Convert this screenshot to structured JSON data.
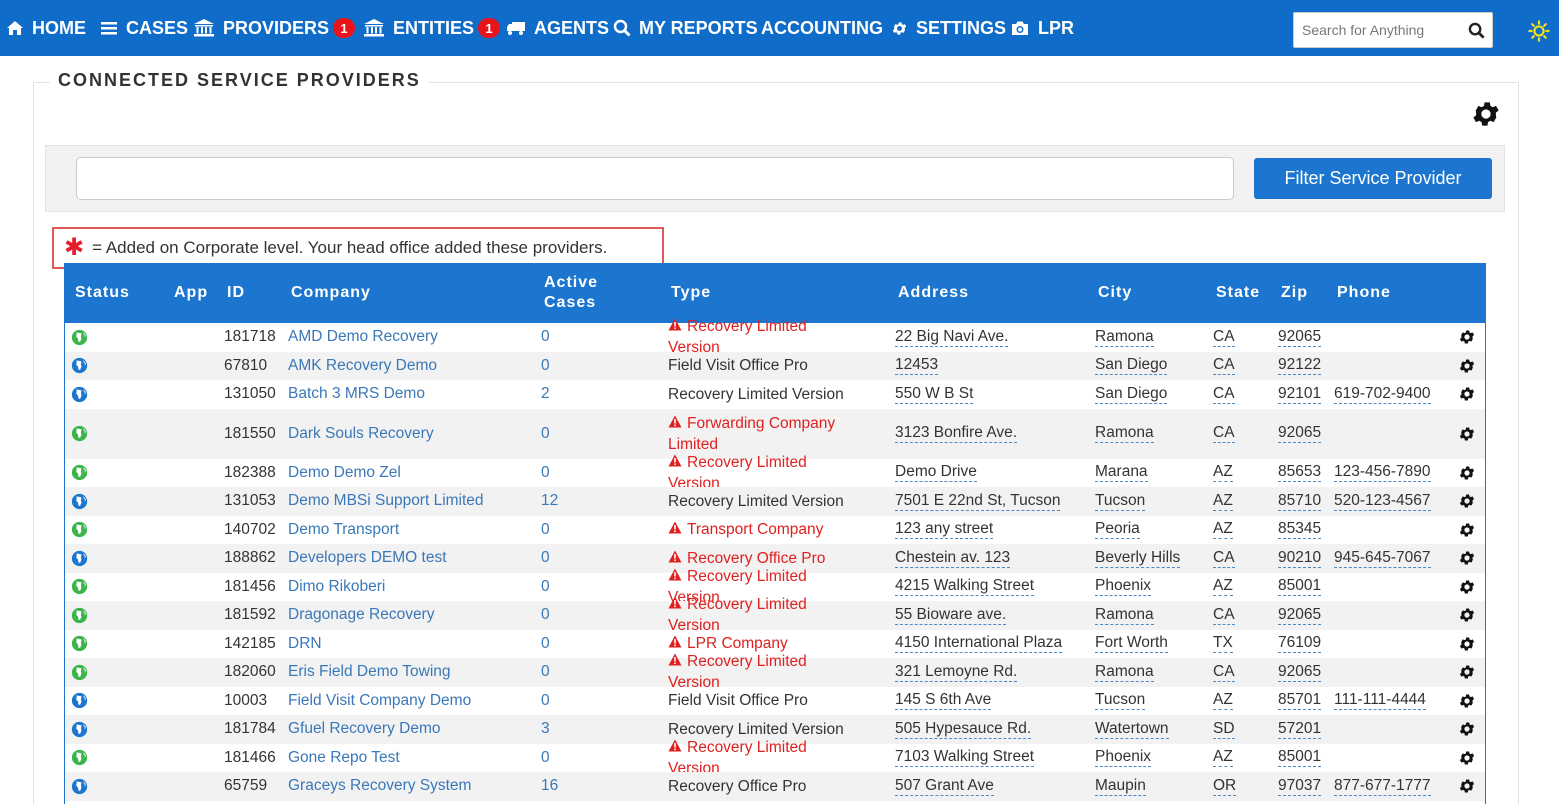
{
  "nav": {
    "items": [
      {
        "label": "HOME",
        "icon": "home-icon"
      },
      {
        "label": "CASES",
        "icon": "bars-icon"
      },
      {
        "label": "PROVIDERS",
        "icon": "bank-icon",
        "badge": "1"
      },
      {
        "label": "ENTITIES",
        "icon": "bank-icon",
        "badge": "1"
      },
      {
        "label": "AGENTS",
        "icon": "truck-icon"
      },
      {
        "label": "MY REPORTS",
        "icon": "search-icon"
      },
      {
        "label": "ACCOUNTING",
        "icon": ""
      },
      {
        "label": "SETTINGS",
        "icon": "gear-icon"
      },
      {
        "label": "LPR",
        "icon": "camera-icon"
      }
    ],
    "search_placeholder": "Search for Anything"
  },
  "page": {
    "title": "CONNECTED SERVICE PROVIDERS",
    "filter_button": "Filter Service Provider",
    "filter_value": "",
    "note_marker": "✱",
    "note_text": "= Added on Corporate level. Your head office added these providers."
  },
  "table": {
    "headers": {
      "status": "Status",
      "app": "App",
      "id": "ID",
      "company": "Company",
      "active_cases_1": "Active",
      "active_cases_2": "Cases",
      "type": "Type",
      "address": "Address",
      "city": "City",
      "state": "State",
      "zip": "Zip",
      "phone": "Phone"
    },
    "rows": [
      {
        "status": "green",
        "id": "181718",
        "company": "AMD Demo Recovery",
        "cases": "0",
        "type": "Recovery Limited Version",
        "warn": true,
        "address": "22 Big Navi Ave.",
        "city": "Ramona",
        "state": "CA",
        "zip": "92065",
        "phone": ""
      },
      {
        "status": "blue",
        "id": "67810",
        "company": "AMK Recovery Demo",
        "cases": "0",
        "type": "Field Visit Office Pro",
        "warn": false,
        "address": "12453",
        "city": "San Diego",
        "state": "CA",
        "zip": "92122",
        "phone": ""
      },
      {
        "status": "blue",
        "id": "131050",
        "company": "Batch 3 MRS Demo",
        "cases": "2",
        "type": "Recovery Limited Version",
        "warn": false,
        "address": "550 W B St",
        "city": "San Diego",
        "state": "CA",
        "zip": "92101",
        "phone": "619-702-9400"
      },
      {
        "status": "green",
        "id": "181550",
        "company": "Dark Souls Recovery",
        "cases": "0",
        "type": "Forwarding Company Limited",
        "warn": true,
        "address": "3123 Bonfire Ave.",
        "city": "Ramona",
        "state": "CA",
        "zip": "92065",
        "phone": ""
      },
      {
        "status": "green",
        "id": "182388",
        "company": "Demo Demo Zel",
        "cases": "0",
        "type": "Recovery Limited Version",
        "warn": true,
        "address": "Demo Drive",
        "city": "Marana",
        "state": "AZ",
        "zip": "85653",
        "phone": "123-456-7890"
      },
      {
        "status": "blue",
        "id": "131053",
        "company": "Demo MBSi Support Limited",
        "cases": "12",
        "type": "Recovery Limited Version",
        "warn": false,
        "address": "7501 E 22nd St, Tucson",
        "city": "Tucson",
        "state": "AZ",
        "zip": "85710",
        "phone": "520-123-4567"
      },
      {
        "status": "green",
        "id": "140702",
        "company": "Demo Transport",
        "cases": "0",
        "type": "Transport Company",
        "warn": true,
        "address": "123 any street",
        "city": "Peoria",
        "state": "AZ",
        "zip": "85345",
        "phone": ""
      },
      {
        "status": "blue",
        "id": "188862",
        "company": "Developers DEMO test",
        "cases": "0",
        "type": "Recovery Office Pro",
        "warn": true,
        "address": "Chestein av. 123",
        "city": "Beverly Hills",
        "state": "CA",
        "zip": "90210",
        "phone": "945-645-7067"
      },
      {
        "status": "green",
        "id": "181456",
        "company": "Dimo Rikoberi",
        "cases": "0",
        "type": "Recovery Limited Version",
        "warn": true,
        "address": "4215 Walking Street",
        "city": "Phoenix",
        "state": "AZ",
        "zip": "85001",
        "phone": ""
      },
      {
        "status": "green",
        "id": "181592",
        "company": "Dragonage Recovery",
        "cases": "0",
        "type": "Recovery Limited Version",
        "warn": true,
        "address": "55 Bioware ave.",
        "city": "Ramona",
        "state": "CA",
        "zip": "92065",
        "phone": ""
      },
      {
        "status": "green",
        "id": "142185",
        "company": "DRN",
        "cases": "0",
        "type": "LPR Company",
        "warn": true,
        "address": "4150 International Plaza",
        "city": "Fort Worth",
        "state": "TX",
        "zip": "76109",
        "phone": ""
      },
      {
        "status": "green",
        "id": "182060",
        "company": "Eris Field Demo Towing",
        "cases": "0",
        "type": "Recovery Limited Version",
        "warn": true,
        "address": "321 Lemoyne Rd.",
        "city": "Ramona",
        "state": "CA",
        "zip": "92065",
        "phone": ""
      },
      {
        "status": "blue",
        "id": "10003",
        "company": "Field Visit Company Demo",
        "cases": "0",
        "type": "Field Visit Office Pro",
        "warn": false,
        "address": "145 S 6th Ave",
        "city": "Tucson",
        "state": "AZ",
        "zip": "85701",
        "phone": "111-111-4444"
      },
      {
        "status": "blue",
        "id": "181784",
        "company": "Gfuel Recovery Demo",
        "cases": "3",
        "type": "Recovery Limited Version",
        "warn": false,
        "address": "505 Hypesauce Rd.",
        "city": "Watertown",
        "state": "SD",
        "zip": "57201",
        "phone": ""
      },
      {
        "status": "green",
        "id": "181466",
        "company": "Gone Repo Test",
        "cases": "0",
        "type": "Recovery Limited Version",
        "warn": true,
        "address": "7103 Walking Street",
        "city": "Phoenix",
        "state": "AZ",
        "zip": "85001",
        "phone": ""
      },
      {
        "status": "blue",
        "id": "65759",
        "company": "Graceys Recovery System",
        "cases": "16",
        "type": "Recovery Office Pro",
        "warn": false,
        "address": "507 Grant Ave",
        "city": "Maupin",
        "state": "OR",
        "zip": "97037",
        "phone": "877-677-1777"
      }
    ]
  },
  "colors": {
    "nav": "#0f6cc8",
    "accent": "#1c75cf",
    "warn": "#e02020",
    "link": "#3a78b8",
    "globe_green": "#3bb54a",
    "globe_blue": "#1c75cf"
  }
}
